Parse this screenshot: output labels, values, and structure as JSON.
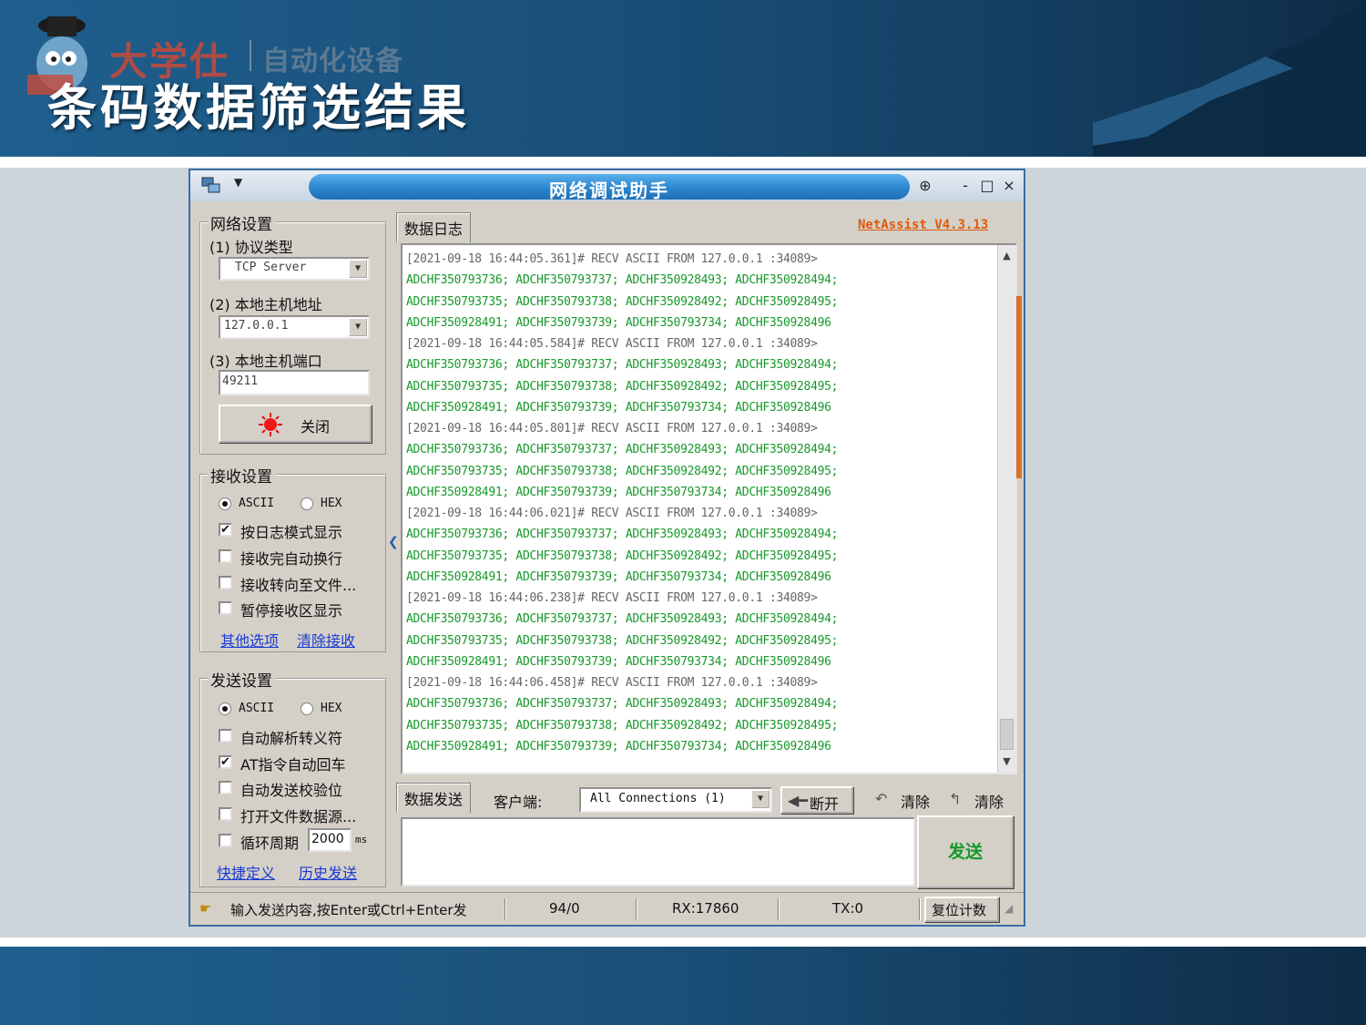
{
  "slide": {
    "brand": "大学仕",
    "brand_sub": "自动化设备",
    "title": "条码数据筛选结果"
  },
  "window": {
    "title": "网络调试助手",
    "version": "NetAssist V4.3.13",
    "controls": {
      "pin": "⊕",
      "minimize": "-",
      "maximize": "□",
      "close": "×"
    }
  },
  "network": {
    "group_title": "网络设置",
    "protocol_label": "(1) 协议类型",
    "protocol_value": "TCP Server",
    "host_label": "(2) 本地主机地址",
    "host_value": "127.0.0.1",
    "port_label": "(3) 本地主机端口",
    "port_value": "49211",
    "close_button": "关闭"
  },
  "receive": {
    "group_title": "接收设置",
    "ascii": "ASCII",
    "hex": "HEX",
    "options": [
      {
        "label": "按日志模式显示",
        "checked": true
      },
      {
        "label": "接收完自动换行",
        "checked": false
      },
      {
        "label": "接收转向至文件...",
        "checked": false
      },
      {
        "label": "暂停接收区显示",
        "checked": false
      }
    ],
    "link_other": "其他选项",
    "link_clear": "清除接收"
  },
  "send": {
    "group_title": "发送设置",
    "ascii": "ASCII",
    "hex": "HEX",
    "options": [
      {
        "label": "自动解析转义符",
        "checked": false
      },
      {
        "label": "AT指令自动回车",
        "checked": true
      },
      {
        "label": "自动发送校验位",
        "checked": false
      },
      {
        "label": "打开文件数据源...",
        "checked": false
      }
    ],
    "cycle_label": "循环周期",
    "cycle_value": "2000",
    "cycle_unit": "ms",
    "link_shortcut": "快捷定义",
    "link_history": "历史发送"
  },
  "log": {
    "tab_label": "数据日志",
    "lines": [
      {
        "type": "hdr",
        "text": "[2021-09-18 16:44:05.361]# RECV ASCII FROM 127.0.0.1 :34089>"
      },
      {
        "type": "dat",
        "text": "ADCHF350793736; ADCHF350793737; ADCHF350928493; ADCHF350928494;"
      },
      {
        "type": "dat",
        "text": "ADCHF350793735; ADCHF350793738; ADCHF350928492; ADCHF350928495;"
      },
      {
        "type": "dat",
        "text": "ADCHF350928491; ADCHF350793739; ADCHF350793734; ADCHF350928496"
      },
      {
        "type": "hdr",
        "text": "[2021-09-18 16:44:05.584]# RECV ASCII FROM 127.0.0.1 :34089>"
      },
      {
        "type": "dat",
        "text": "ADCHF350793736; ADCHF350793737; ADCHF350928493; ADCHF350928494;"
      },
      {
        "type": "dat",
        "text": "ADCHF350793735; ADCHF350793738; ADCHF350928492; ADCHF350928495;"
      },
      {
        "type": "dat",
        "text": "ADCHF350928491; ADCHF350793739; ADCHF350793734; ADCHF350928496"
      },
      {
        "type": "hdr",
        "text": "[2021-09-18 16:44:05.801]# RECV ASCII FROM 127.0.0.1 :34089>"
      },
      {
        "type": "dat",
        "text": "ADCHF350793736; ADCHF350793737; ADCHF350928493; ADCHF350928494;"
      },
      {
        "type": "dat",
        "text": "ADCHF350793735; ADCHF350793738; ADCHF350928492; ADCHF350928495;"
      },
      {
        "type": "dat",
        "text": "ADCHF350928491; ADCHF350793739; ADCHF350793734; ADCHF350928496"
      },
      {
        "type": "hdr",
        "text": "[2021-09-18 16:44:06.021]# RECV ASCII FROM 127.0.0.1 :34089>"
      },
      {
        "type": "dat",
        "text": "ADCHF350793736; ADCHF350793737; ADCHF350928493; ADCHF350928494;"
      },
      {
        "type": "dat",
        "text": "ADCHF350793735; ADCHF350793738; ADCHF350928492; ADCHF350928495;"
      },
      {
        "type": "dat",
        "text": "ADCHF350928491; ADCHF350793739; ADCHF350793734; ADCHF350928496"
      },
      {
        "type": "hdr",
        "text": "[2021-09-18 16:44:06.238]# RECV ASCII FROM 127.0.0.1 :34089>"
      },
      {
        "type": "dat",
        "text": "ADCHF350793736; ADCHF350793737; ADCHF350928493; ADCHF350928494;"
      },
      {
        "type": "dat",
        "text": "ADCHF350793735; ADCHF350793738; ADCHF350928492; ADCHF350928495;"
      },
      {
        "type": "dat",
        "text": "ADCHF350928491; ADCHF350793739; ADCHF350793734; ADCHF350928496"
      },
      {
        "type": "hdr",
        "text": "[2021-09-18 16:44:06.458]# RECV ASCII FROM 127.0.0.1 :34089>"
      },
      {
        "type": "dat",
        "text": "ADCHF350793736; ADCHF350793737; ADCHF350928493; ADCHF350928494;"
      },
      {
        "type": "dat",
        "text": "ADCHF350793735; ADCHF350793738; ADCHF350928492; ADCHF350928495;"
      },
      {
        "type": "dat",
        "text": "ADCHF350928491; ADCHF350793739; ADCHF350793734; ADCHF350928496"
      }
    ]
  },
  "sendbar": {
    "tab_label": "数据发送",
    "client_label": "客户端:",
    "client_value": "All Connections (1)",
    "disconnect": "断开",
    "clear1": "清除",
    "clear2": "清除",
    "send_button": "发送"
  },
  "status": {
    "hint": "输入发送内容,按Enter或Ctrl+Enter发",
    "counter": "94/0",
    "rx": "RX:17860",
    "tx": "TX:0",
    "reset": "复位计数"
  },
  "colors": {
    "accent_green": "#16992a",
    "version_orange": "#e05a0a",
    "link_blue": "#1a3ad6",
    "title_blue": "#2c86cf"
  },
  "icons": [
    "search-icon",
    "pushpin-icon",
    "minimize-icon",
    "maximize-icon",
    "close-icon",
    "red-light-icon",
    "left-arrow-icon",
    "clear-icon",
    "hand-pointer-icon"
  ]
}
